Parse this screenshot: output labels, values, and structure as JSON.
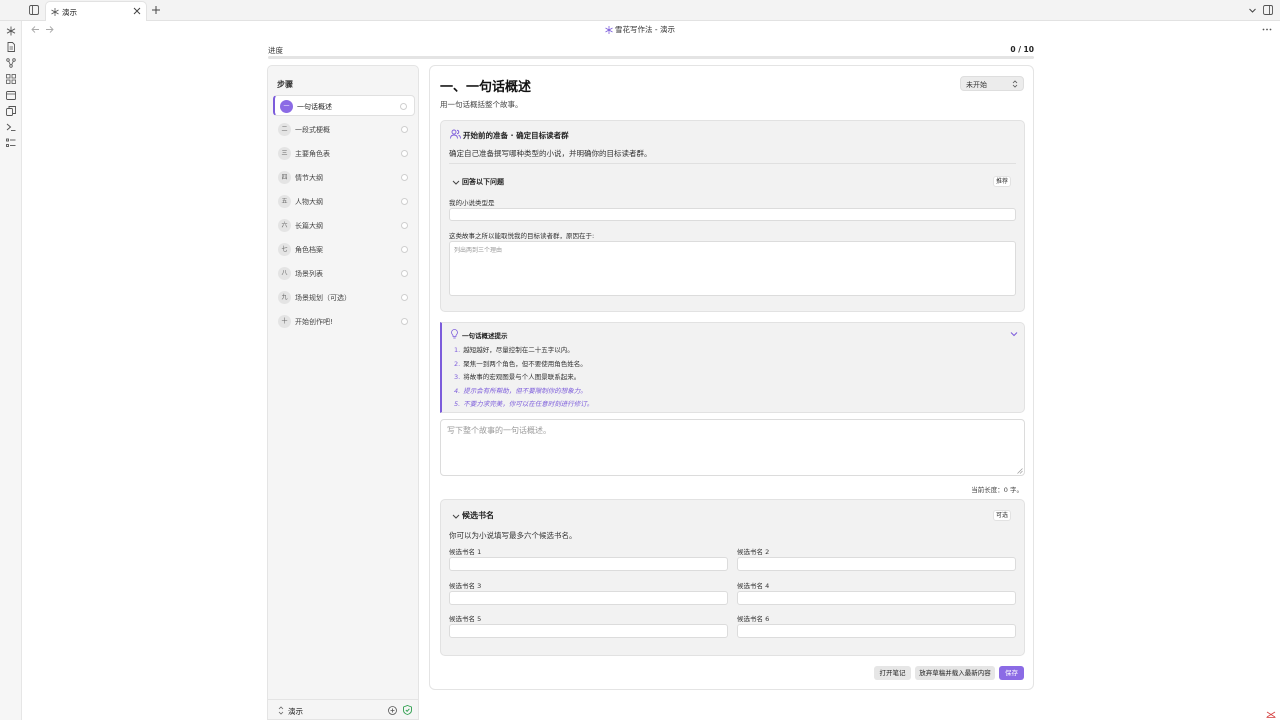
{
  "tab": {
    "title": "演示",
    "icon": "snowflake-icon"
  },
  "view": {
    "title": "雪花写作法 - 演示"
  },
  "progress": {
    "label": "进度",
    "count": "0 / 10",
    "fraction": 0
  },
  "steps": {
    "title": "步骤",
    "items": [
      {
        "num": "一",
        "label": "一句话概述",
        "active": true
      },
      {
        "num": "二",
        "label": "一段式梗概",
        "active": false
      },
      {
        "num": "三",
        "label": "主要角色表",
        "active": false
      },
      {
        "num": "四",
        "label": "情节大纲",
        "active": false
      },
      {
        "num": "五",
        "label": "人物大纲",
        "active": false
      },
      {
        "num": "六",
        "label": "长篇大纲",
        "active": false
      },
      {
        "num": "七",
        "label": "角色档案",
        "active": false
      },
      {
        "num": "八",
        "label": "场景列表",
        "active": false
      },
      {
        "num": "九",
        "label": "场景规划（可选）",
        "active": false
      },
      {
        "num": "十",
        "label": "开始创作吧!",
        "active": false
      }
    ],
    "vault": "演示"
  },
  "main": {
    "title": "一、一句话概述",
    "subtitle": "用一句话概括整个故事。",
    "status": "未开始",
    "prep": {
      "title": "开始前的准备 · 确定目标读者群",
      "desc": "确定自己准备撰写哪种类型的小说，并明确你的目标读者群。",
      "questions_title": "回答以下问题",
      "badge": "推荐",
      "field1_label": "我的小说类型是",
      "field1_value": "",
      "field2_label": "这类故事之所以能取悦我的目标读者群，原因在于:",
      "field2_placeholder": "列出两到三个理由"
    },
    "tips": {
      "title": "一句话概述提示",
      "items": [
        {
          "n": "1.",
          "text": "越短越好，尽量控制在二十五字以内。",
          "em": false
        },
        {
          "n": "2.",
          "text": "聚焦一到两个角色，但不要使用角色姓名。",
          "em": false
        },
        {
          "n": "3.",
          "text": "将故事的宏观图景与个人图景联系起来。",
          "em": false
        },
        {
          "n": "4.",
          "text": "提示会有所帮助，但不要限制你的想象力。",
          "em": true
        },
        {
          "n": "5.",
          "text": "不要力求完美，你可以在任意时刻进行修订。",
          "em": true
        }
      ]
    },
    "summary_placeholder": "写下整个故事的一句话概述。",
    "length_text": "当前长度：0 字。",
    "titles": {
      "title": "候选书名",
      "badge": "可选",
      "desc": "你可以为小说填写最多六个候选书名。",
      "labels": [
        "候选书名 1",
        "候选书名 2",
        "候选书名 3",
        "候选书名 4",
        "候选书名 5",
        "候选书名 6"
      ]
    },
    "buttons": {
      "open_notes": "打开笔记",
      "discard": "放弃草稿并载入最新内容",
      "save": "保存"
    }
  },
  "colors": {
    "accent": "#7c5cdb",
    "accent_light": "#8b6be5"
  }
}
